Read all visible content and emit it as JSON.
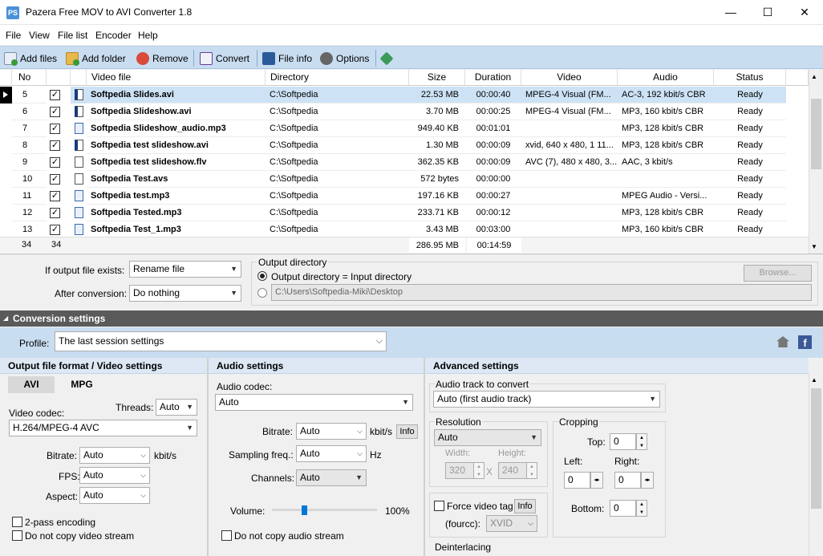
{
  "window": {
    "title": "Pazera Free MOV to AVI Converter 1.8",
    "app_icon_text": "PS",
    "minimize": "—",
    "maximize": "☐",
    "close": "✕"
  },
  "menu": [
    "File",
    "View",
    "File list",
    "Encoder",
    "Help"
  ],
  "toolbar": {
    "add_files": "Add files",
    "add_folder": "Add folder",
    "remove": "Remove",
    "convert": "Convert",
    "file_info": "File info",
    "options": "Options"
  },
  "table": {
    "headers": [
      "No",
      "",
      "Video file",
      "Directory",
      "Size",
      "Duration",
      "Video",
      "Audio",
      "Status"
    ],
    "rows": [
      {
        "no": "5",
        "file": "Softpedia Slides.avi",
        "dir": "C:\\Softpedia",
        "size": "22.53 MB",
        "duration": "00:00:40",
        "video": "MPEG-4 Visual (FM...",
        "audio": "AC-3, 192 kbit/s  CBR",
        "status": "Ready",
        "icon": "video-file-icon"
      },
      {
        "no": "6",
        "file": "Softpedia Slideshow.avi",
        "dir": "C:\\Softpedia",
        "size": "3.70 MB",
        "duration": "00:00:25",
        "video": "MPEG-4 Visual (FM...",
        "audio": "MP3, 160 kbit/s  CBR",
        "status": "Ready",
        "icon": "video-file-icon"
      },
      {
        "no": "7",
        "file": "Softpedia Slideshow_audio.mp3",
        "dir": "C:\\Softpedia",
        "size": "949.40 KB",
        "duration": "00:01:01",
        "video": "",
        "audio": "MP3, 128 kbit/s  CBR",
        "status": "Ready",
        "icon": "audio-file-icon"
      },
      {
        "no": "8",
        "file": "Softpedia test slideshow.avi",
        "dir": "C:\\Softpedia",
        "size": "1.30 MB",
        "duration": "00:00:09",
        "video": "xvid, 640 x 480, 1 11...",
        "audio": "MP3, 128 kbit/s  CBR",
        "status": "Ready",
        "icon": "video-file-icon"
      },
      {
        "no": "9",
        "file": "Softpedia test slideshow.flv",
        "dir": "C:\\Softpedia",
        "size": "362.35 KB",
        "duration": "00:00:09",
        "video": "AVC (7), 480 x 480, 3...",
        "audio": "AAC, 3 kbit/s",
        "status": "Ready",
        "icon": "blank-file-icon"
      },
      {
        "no": "10",
        "file": "Softpedia Test.avs",
        "dir": "C:\\Softpedia",
        "size": "572 bytes",
        "duration": "00:00:00",
        "video": "",
        "audio": "",
        "status": "Ready",
        "icon": "blank-file-icon"
      },
      {
        "no": "11",
        "file": "Softpedia test.mp3",
        "dir": "C:\\Softpedia",
        "size": "197.16 KB",
        "duration": "00:00:27",
        "video": "",
        "audio": "MPEG Audio - Versi...",
        "status": "Ready",
        "icon": "audio-file-icon"
      },
      {
        "no": "12",
        "file": "Softpedia Tested.mp3",
        "dir": "C:\\Softpedia",
        "size": "233.71 KB",
        "duration": "00:00:12",
        "video": "",
        "audio": "MP3, 128 kbit/s  CBR",
        "status": "Ready",
        "icon": "audio-file-icon"
      },
      {
        "no": "13",
        "file": "Softpedia Test_1.mp3",
        "dir": "C:\\Softpedia",
        "size": "3.43 MB",
        "duration": "00:03:00",
        "video": "",
        "audio": "MP3, 160 kbit/s  CBR",
        "status": "Ready",
        "icon": "audio-file-icon"
      }
    ],
    "footer": {
      "count": "34",
      "checked": "34",
      "total_size": "286.95 MB",
      "total_duration": "00:14:59"
    }
  },
  "output": {
    "if_exists_label": "If output file exists:",
    "if_exists_value": "Rename file",
    "after_label": "After conversion:",
    "after_value": "Do nothing",
    "dir_title": "Output directory",
    "radio_input": "Output directory = Input directory",
    "custom_path": "C:\\Users\\Softpedia-Miki\\Desktop",
    "browse": "Browse..."
  },
  "conversion": {
    "title": "Conversion settings",
    "profile_label": "Profile:",
    "profile_value": "The last session settings"
  },
  "video": {
    "head": "Output file format / Video settings",
    "tab_avi": "AVI",
    "tab_mpg": "MPG",
    "threads_label": "Threads:",
    "threads_value": "Auto",
    "codec_label": "Video codec:",
    "codec_value": "H.264/MPEG-4 AVC",
    "bitrate_label": "Bitrate:",
    "bitrate_value": "Auto",
    "bitrate_unit": "kbit/s",
    "fps_label": "FPS:",
    "fps_value": "Auto",
    "aspect_label": "Aspect:",
    "aspect_value": "Auto",
    "two_pass": "2-pass encoding",
    "no_copy": "Do not copy video stream"
  },
  "audio": {
    "head": "Audio settings",
    "codec_label": "Audio codec:",
    "codec_value": "Auto",
    "bitrate_label": "Bitrate:",
    "bitrate_value": "Auto",
    "bitrate_unit": "kbit/s",
    "info": "Info",
    "samp_label": "Sampling freq.:",
    "samp_value": "Auto",
    "samp_unit": "Hz",
    "channels_label": "Channels:",
    "channels_value": "Auto",
    "volume_label": "Volume:",
    "volume_value": "100%",
    "volume_level": 0.3,
    "no_copy": "Do not copy audio stream"
  },
  "advanced": {
    "head": "Advanced settings",
    "track_label": "Audio track to convert",
    "track_value": "Auto (first audio track)",
    "res_title": "Resolution",
    "res_value": "Auto",
    "width_label": "Width:",
    "width_value": "320",
    "height_label": "Height:",
    "height_value": "240",
    "x_sep": "X",
    "crop_title": "Cropping",
    "top_label": "Top:",
    "top_value": "0",
    "left_label": "Left:",
    "left_value": "0",
    "right_label": "Right:",
    "right_value": "0",
    "bottom_label": "Bottom:",
    "bottom_value": "0",
    "force_tag": "Force video tag",
    "info": "Info",
    "fourcc_label": "(fourcc):",
    "fourcc_value": "XVID",
    "deint_title": "Deinterlacing"
  }
}
